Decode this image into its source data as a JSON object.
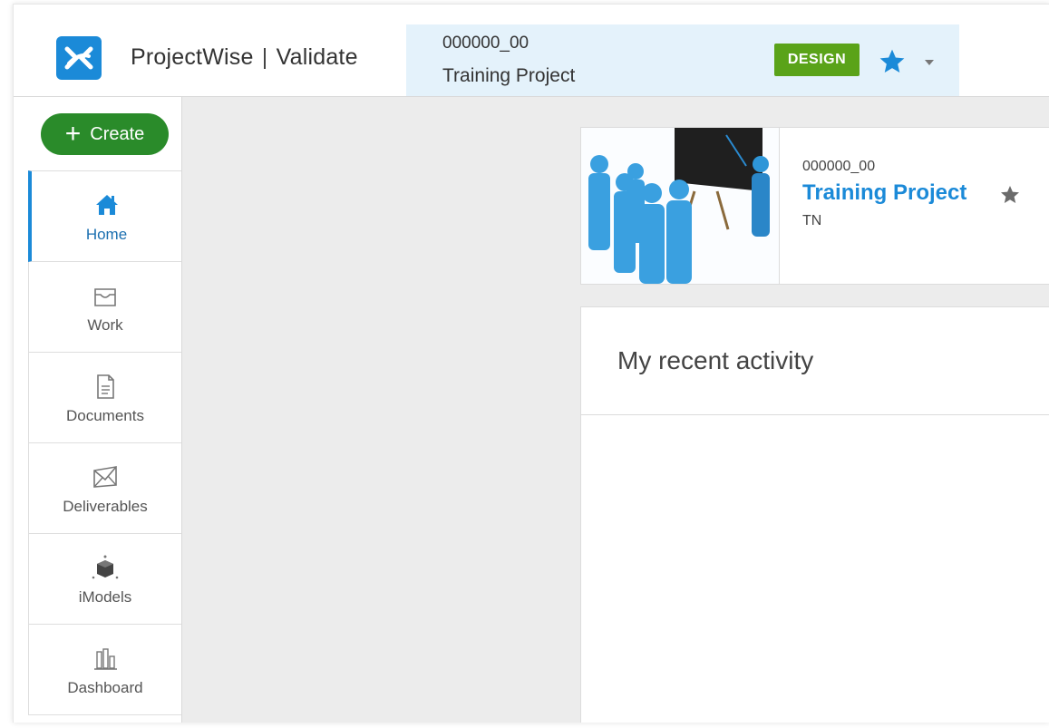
{
  "header": {
    "app_name_left": "ProjectWise",
    "separator": "|",
    "app_name_right": "Validate",
    "context": {
      "project_number": "000000_00",
      "project_name": "Training Project",
      "badge": "DESIGN",
      "star_icon": "star-icon",
      "caret_icon": "caret-down-icon"
    }
  },
  "sidebar": {
    "create_plus": "+",
    "create_label": "Create",
    "items": [
      {
        "label": "Home",
        "icon": "home-icon",
        "active": true
      },
      {
        "label": "Work",
        "icon": "inbox-icon",
        "active": false
      },
      {
        "label": "Documents",
        "icon": "document-icon",
        "active": false
      },
      {
        "label": "Deliverables",
        "icon": "envelope-icon",
        "active": false
      },
      {
        "label": "iModels",
        "icon": "imodel-cube-icon",
        "active": false
      },
      {
        "label": "Dashboard",
        "icon": "bar-chart-icon",
        "active": false
      }
    ]
  },
  "main": {
    "project_card": {
      "number": "000000_00",
      "title": "Training Project",
      "code": "TN",
      "star_icon": "star-icon"
    },
    "activity": {
      "title": "My recent activity"
    }
  },
  "colors": {
    "accent": "#1b8ad8",
    "create_button": "#2a8b2a",
    "badge": "#5aa319",
    "context_bg": "#e4f2fb",
    "main_bg": "#ececec"
  }
}
